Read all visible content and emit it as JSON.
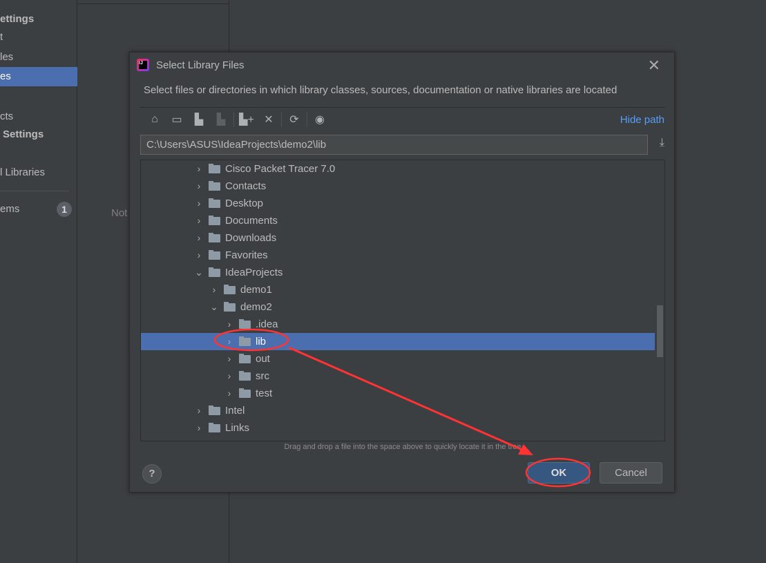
{
  "sidebar": {
    "items": [
      {
        "label": "ettings"
      },
      {
        "label": "t"
      },
      {
        "label": "les"
      },
      {
        "label": "es"
      },
      {
        "label": "cts"
      },
      {
        "label": "Settings"
      },
      {
        "label": "l Libraries"
      },
      {
        "label": "ems"
      }
    ],
    "badge": "1"
  },
  "main": {
    "placeholder_text": "Not"
  },
  "dialog": {
    "title": "Select Library Files",
    "description": "Select files or directories in which library classes, sources, documentation or native libraries are located",
    "hide_path": "Hide path",
    "path_value": "C:\\Users\\ASUS\\IdeaProjects\\demo2\\lib",
    "tree": [
      {
        "label": "Cisco Packet Tracer 7.0",
        "level": 0,
        "expanded": false
      },
      {
        "label": "Contacts",
        "level": 0,
        "expanded": false
      },
      {
        "label": "Desktop",
        "level": 0,
        "expanded": false
      },
      {
        "label": "Documents",
        "level": 0,
        "expanded": false
      },
      {
        "label": "Downloads",
        "level": 0,
        "expanded": false
      },
      {
        "label": "Favorites",
        "level": 0,
        "expanded": false
      },
      {
        "label": "IdeaProjects",
        "level": 0,
        "expanded": true
      },
      {
        "label": "demo1",
        "level": 1,
        "expanded": false
      },
      {
        "label": "demo2",
        "level": 1,
        "expanded": true
      },
      {
        "label": ".idea",
        "level": 2,
        "expanded": false
      },
      {
        "label": "lib",
        "level": 2,
        "expanded": false,
        "selected": true
      },
      {
        "label": "out",
        "level": 2,
        "expanded": false
      },
      {
        "label": "src",
        "level": 2,
        "expanded": false
      },
      {
        "label": "test",
        "level": 2,
        "expanded": false
      },
      {
        "label": "Intel",
        "level": 0,
        "expanded": false
      },
      {
        "label": "Links",
        "level": 0,
        "expanded": false
      }
    ],
    "hint": "Drag and drop a file into the space above to quickly locate it in the tree",
    "ok": "OK",
    "cancel": "Cancel",
    "help": "?",
    "close": "✕"
  },
  "colors": {
    "selection": "#4b6eaf",
    "annotation": "#ff3333",
    "link": "#589df6"
  }
}
